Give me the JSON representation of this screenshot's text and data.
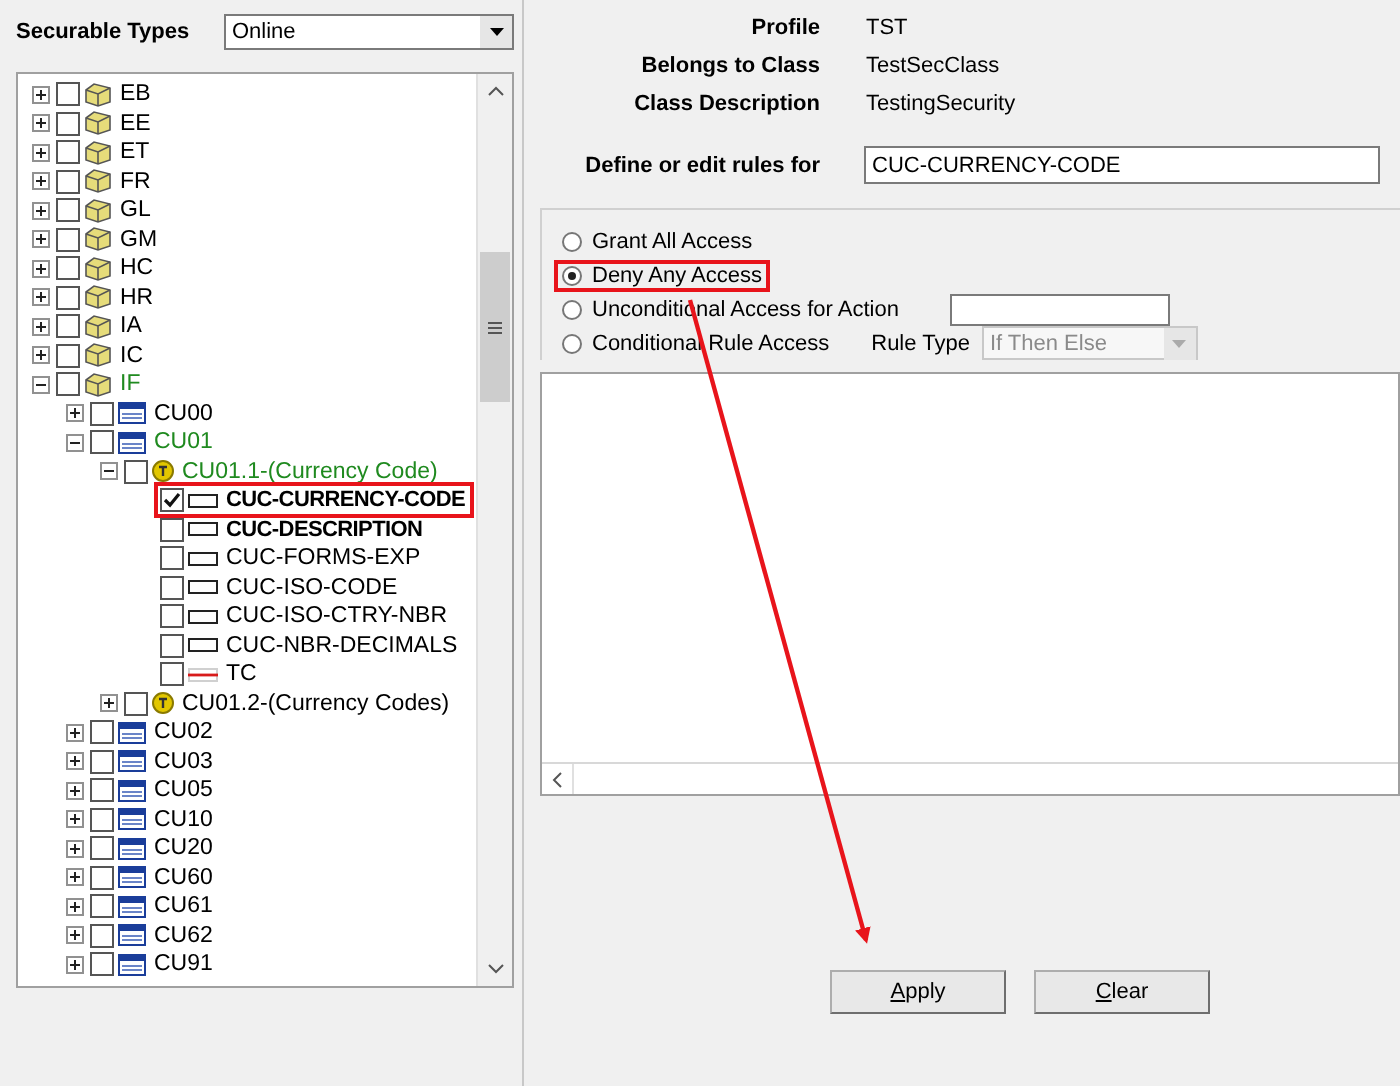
{
  "securable_types": {
    "label": "Securable Types",
    "value": "Online"
  },
  "tree": {
    "items": [
      {
        "label": "EB",
        "kind": "folder",
        "checked": false,
        "expanded": false
      },
      {
        "label": "EE",
        "kind": "folder",
        "checked": false,
        "expanded": false
      },
      {
        "label": "ET",
        "kind": "folder",
        "checked": false,
        "expanded": false
      },
      {
        "label": "FR",
        "kind": "folder",
        "checked": false,
        "expanded": false
      },
      {
        "label": "GL",
        "kind": "folder",
        "checked": false,
        "expanded": false
      },
      {
        "label": "GM",
        "kind": "folder",
        "checked": false,
        "expanded": false
      },
      {
        "label": "HC",
        "kind": "folder",
        "checked": false,
        "expanded": false
      },
      {
        "label": "HR",
        "kind": "folder",
        "checked": false,
        "expanded": false
      },
      {
        "label": "IA",
        "kind": "folder",
        "checked": false,
        "expanded": false
      },
      {
        "label": "IC",
        "kind": "folder",
        "checked": false,
        "expanded": false
      },
      {
        "label": "IF",
        "kind": "folder",
        "checked": false,
        "expanded": true,
        "children": [
          {
            "label": "CU00",
            "kind": "table",
            "checked": false,
            "expanded": false
          },
          {
            "label": "CU01",
            "kind": "table",
            "checked": false,
            "expanded": true,
            "children": [
              {
                "label": "CU01.1-(Currency Code)",
                "kind": "group",
                "checked": false,
                "expanded": true,
                "children": [
                  {
                    "label": "CUC-CURRENCY-CODE",
                    "kind": "field",
                    "checked": true,
                    "key": true,
                    "highlighted": true
                  },
                  {
                    "label": "CUC-DESCRIPTION",
                    "kind": "field",
                    "checked": false,
                    "key": true,
                    "highlighted": false
                  },
                  {
                    "label": "CUC-FORMS-EXP",
                    "kind": "field",
                    "checked": false,
                    "key": false,
                    "highlighted": false
                  },
                  {
                    "label": "CUC-ISO-CODE",
                    "kind": "field",
                    "checked": false,
                    "key": false,
                    "highlighted": false
                  },
                  {
                    "label": "CUC-ISO-CTRY-NBR",
                    "kind": "field",
                    "checked": false,
                    "key": false,
                    "highlighted": false
                  },
                  {
                    "label": "CUC-NBR-DECIMALS",
                    "kind": "field",
                    "checked": false,
                    "key": false,
                    "highlighted": false
                  },
                  {
                    "label": "TC",
                    "kind": "relation",
                    "checked": false,
                    "key": false,
                    "highlighted": false
                  }
                ]
              },
              {
                "label": "CU01.2-(Currency Codes)",
                "kind": "group",
                "checked": false,
                "expanded": false
              }
            ]
          },
          {
            "label": "CU02",
            "kind": "table",
            "checked": false,
            "expanded": false
          },
          {
            "label": "CU03",
            "kind": "table",
            "checked": false,
            "expanded": false
          },
          {
            "label": "CU05",
            "kind": "table",
            "checked": false,
            "expanded": false
          },
          {
            "label": "CU10",
            "kind": "table",
            "checked": false,
            "expanded": false
          },
          {
            "label": "CU20",
            "kind": "table",
            "checked": false,
            "expanded": false
          },
          {
            "label": "CU60",
            "kind": "table",
            "checked": false,
            "expanded": false
          },
          {
            "label": "CU61",
            "kind": "table",
            "checked": false,
            "expanded": false
          },
          {
            "label": "CU62",
            "kind": "table",
            "checked": false,
            "expanded": false
          },
          {
            "label": "CU91",
            "kind": "table",
            "checked": false,
            "expanded": false
          }
        ]
      }
    ]
  },
  "info": [
    {
      "label": "Profile",
      "value": "TST"
    },
    {
      "label": "Belongs to Class",
      "value": "TestSecClass"
    },
    {
      "label": "Class Description",
      "value": "TestingSecurity"
    }
  ],
  "define_rules": {
    "label": "Define or edit rules for",
    "value": "CUC-CURRENCY-CODE"
  },
  "access_options": [
    {
      "label": "Grant All Access",
      "kind": "plain",
      "selected": false,
      "highlighted": false
    },
    {
      "label": "Deny Any Access",
      "kind": "plain",
      "selected": true,
      "highlighted": true
    },
    {
      "label": "Unconditional Access for Action",
      "kind": "action",
      "selected": false,
      "highlighted": false
    },
    {
      "label": "Conditional Rule Access",
      "kind": "rule",
      "selected": false,
      "highlighted": false,
      "rule_type_label": "Rule Type",
      "rule_type_value": "If Then Else",
      "rule_type_disabled": true
    }
  ],
  "buttons": [
    {
      "label": "Apply"
    },
    {
      "label": "Clear"
    }
  ]
}
